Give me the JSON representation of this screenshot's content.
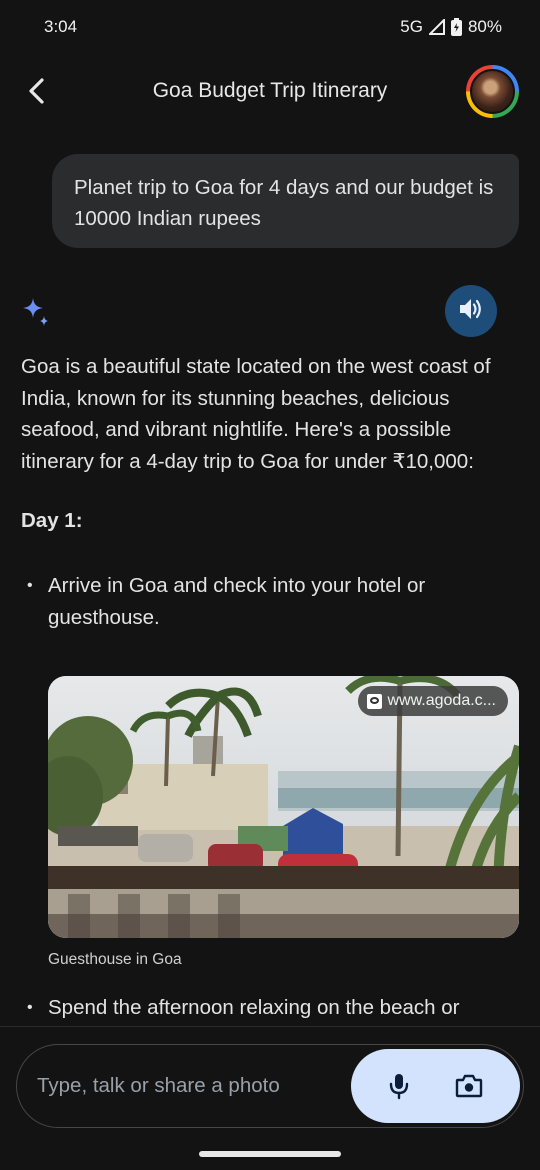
{
  "status_bar": {
    "time": "3:04",
    "network": "5G",
    "battery": "80%"
  },
  "header": {
    "title": "Goa Budget Trip Itinerary",
    "back_icon": "back-arrow-icon",
    "avatar_icon": "profile-avatar"
  },
  "user_message": "Planet trip to Goa for 4 days and our budget is 10000 Indian rupees",
  "response": {
    "intro": "Goa is a beautiful state located on the west coast of India, known for its stunning beaches, delicious seafood, and vibrant nightlife. Here's a possible itinerary for a 4-day trip to Goa for under ₹10,000:",
    "day1_heading": "Day 1:",
    "bullet1": "Arrive in Goa and check into your hotel or guesthouse.",
    "image_source": "www.agoda.c...",
    "image_caption": "Guesthouse in Goa",
    "bullet2": "Spend the afternoon relaxing on the beach or"
  },
  "input": {
    "placeholder": "Type, talk or share a photo"
  },
  "colors": {
    "background": "#131314",
    "bubble": "#2b2c2e",
    "accent_pill": "#d3e3fd",
    "speak_button": "#1f4d7a"
  }
}
